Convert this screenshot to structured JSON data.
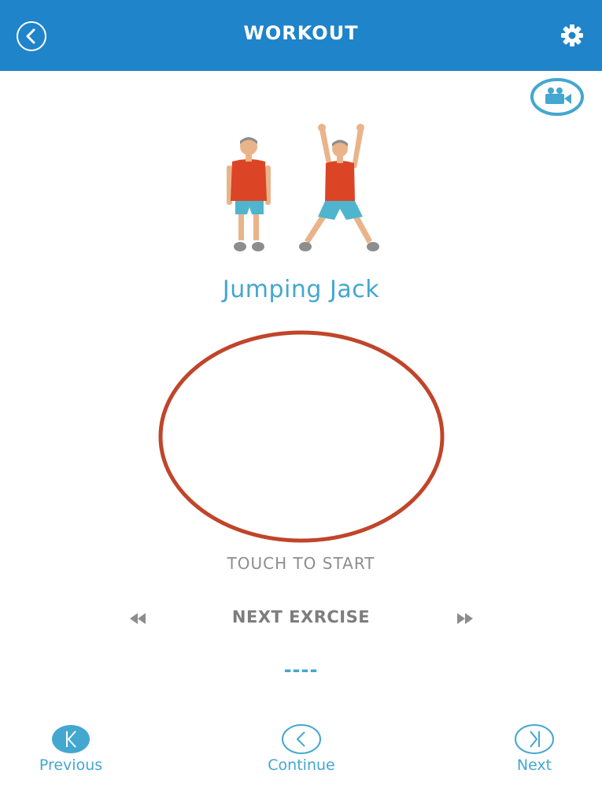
{
  "header": {
    "title": "WORKOUT",
    "back_icon": "back-arrow-icon",
    "settings_icon": "gear-icon"
  },
  "video": {
    "icon": "video-camera-icon"
  },
  "exercise": {
    "name": "Jumping Jack",
    "illustration_icon": "jumping-jack-illustration"
  },
  "timer": {
    "prompt": "TOUCH TO START"
  },
  "next_exercise": {
    "label": "NEXT EXRCISE",
    "value": "----",
    "rewind_icon": "rewind-icon",
    "forward_icon": "fast-forward-icon"
  },
  "bottom_nav": {
    "previous": {
      "label": "Previous",
      "icon": "skip-previous-icon"
    },
    "continue": {
      "label": "Continue",
      "icon": "chevron-left-icon"
    },
    "next": {
      "label": "Next",
      "icon": "skip-next-icon"
    }
  },
  "colors": {
    "primary": "#1f84c9",
    "accent": "#43a7d0",
    "ring": "#c0452a",
    "text_gray": "#8d8d8d"
  }
}
